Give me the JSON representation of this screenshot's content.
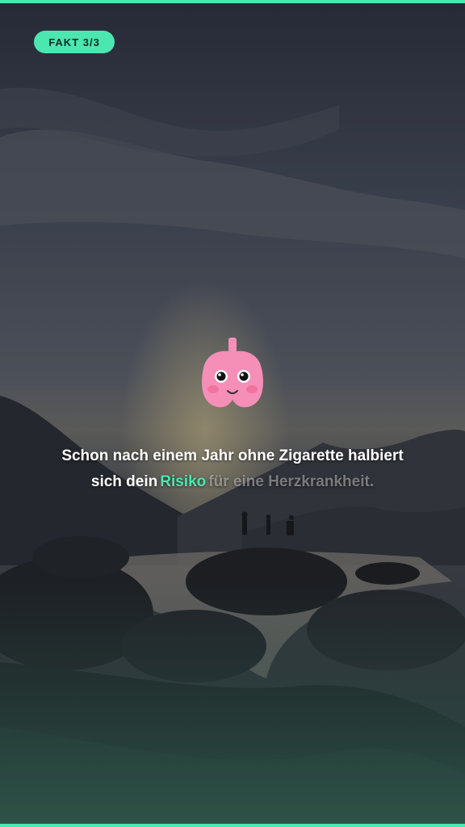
{
  "badge": {
    "label": "FAKT 3/3"
  },
  "fact": {
    "line1": "Schon nach einem Jahr ohne Zigarette halbiert",
    "line2_prefix": "sich dein",
    "highlight": "Risiko",
    "line2_suffix": "für eine Herzkrankheit."
  },
  "progress": {
    "current": 3,
    "total": 3
  },
  "mascot": {
    "icon": "lung-mascot-icon"
  },
  "colors": {
    "accent": "#4ce6b0",
    "mascot_pink": "#f58fb8",
    "overlay_dark": "#1f2430"
  }
}
